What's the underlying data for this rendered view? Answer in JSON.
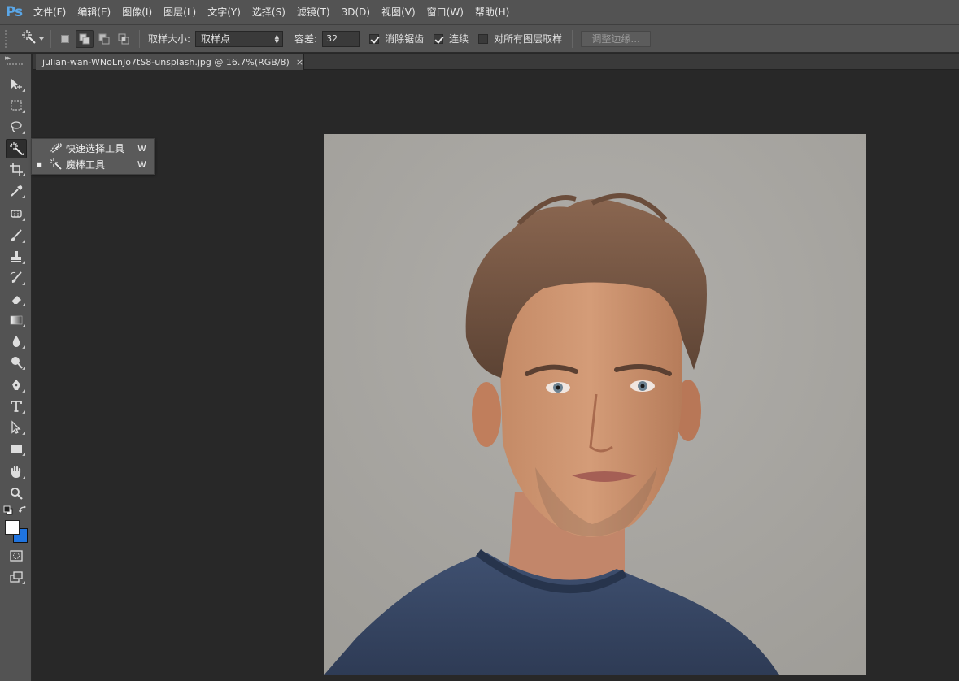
{
  "app": {
    "logo": "Ps"
  },
  "menu": [
    {
      "id": "file",
      "label": "文件(F)"
    },
    {
      "id": "edit",
      "label": "编辑(E)"
    },
    {
      "id": "image",
      "label": "图像(I)"
    },
    {
      "id": "layer",
      "label": "图层(L)"
    },
    {
      "id": "type",
      "label": "文字(Y)"
    },
    {
      "id": "select",
      "label": "选择(S)"
    },
    {
      "id": "filter",
      "label": "滤镜(T)"
    },
    {
      "id": "3d",
      "label": "3D(D)"
    },
    {
      "id": "view",
      "label": "视图(V)"
    },
    {
      "id": "window",
      "label": "窗口(W)"
    },
    {
      "id": "help",
      "label": "帮助(H)"
    }
  ],
  "options": {
    "sample_size_label": "取样大小:",
    "sample_size_value": "取样点",
    "tolerance_label": "容差:",
    "tolerance_value": "32",
    "anti_alias_label": "消除锯齿",
    "anti_alias_checked": true,
    "contiguous_label": "连续",
    "contiguous_checked": true,
    "all_layers_label": "对所有图层取样",
    "all_layers_checked": false,
    "refine_edge_label": "调整边缘..."
  },
  "document": {
    "tab_title": "julian-wan-WNoLnJo7tS8-unsplash.jpg @ 16.7%(RGB/8)",
    "close_glyph": "×"
  },
  "flyout": {
    "items": [
      {
        "label": "快速选择工具",
        "shortcut": "W",
        "selected": false,
        "icon": "quick-selection-icon"
      },
      {
        "label": "魔棒工具",
        "shortcut": "W",
        "selected": true,
        "icon": "magic-wand-icon"
      }
    ],
    "bullet": "■"
  },
  "colors": {
    "foreground": "#ffffff",
    "background": "#1f74e0",
    "chrome": "#535353",
    "workspace": "#282828"
  }
}
